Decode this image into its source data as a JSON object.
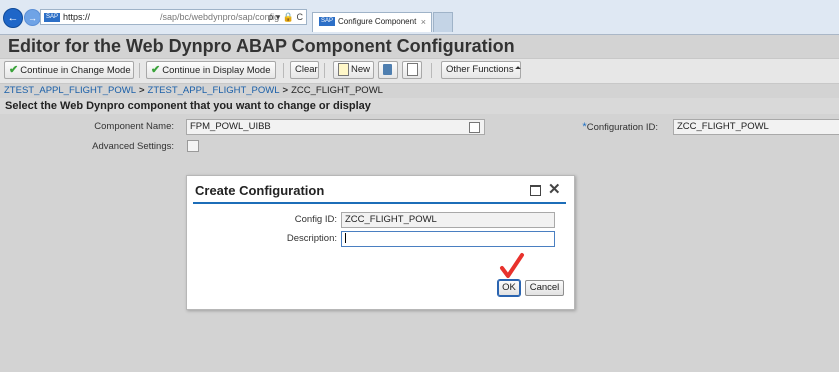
{
  "browser": {
    "url_prefix": "https://",
    "url_path": "/sap/bc/webdynpro/sap/config",
    "url_tail": "ρ ▾ 🔒 C",
    "tab_label": "Configure Component",
    "tab_close": "×",
    "sap_badge": "SAP"
  },
  "app": {
    "title": "Editor for the Web Dynpro ABAP Component Configuration",
    "toolbar": {
      "change_mode": "Continue in Change Mode",
      "display_mode": "Continue in Display Mode",
      "clear": "Clear",
      "new": "New",
      "other_functions": "Other Functions"
    },
    "breadcrumb": [
      "ZTEST_APPL_FLIGHT_POWL",
      "ZTEST_APPL_FLIGHT_POWL",
      "ZCC_FLIGHT_POWL"
    ],
    "breadcrumb_sep": ">",
    "section_title": "Select the Web Dynpro component that you want to change or display",
    "form": {
      "component_label": "Component Name:",
      "component_value": "FPM_POWL_UIBB",
      "config_id_label": "Configuration ID:",
      "config_id_value": "ZCC_FLIGHT_POWL",
      "required_marker": "*",
      "advanced_label": "Advanced Settings:"
    }
  },
  "dialog": {
    "title": "Create Configuration",
    "config_id_label": "Config ID:",
    "config_id_value": "ZCC_FLIGHT_POWL",
    "description_label": "Description:",
    "description_value": "",
    "ok": "OK",
    "cancel": "Cancel",
    "close_glyph": "✕"
  },
  "colors": {
    "link": "#1a5fa8",
    "accent_rule": "#1c6db8",
    "annotation_check": "#e8322c"
  }
}
